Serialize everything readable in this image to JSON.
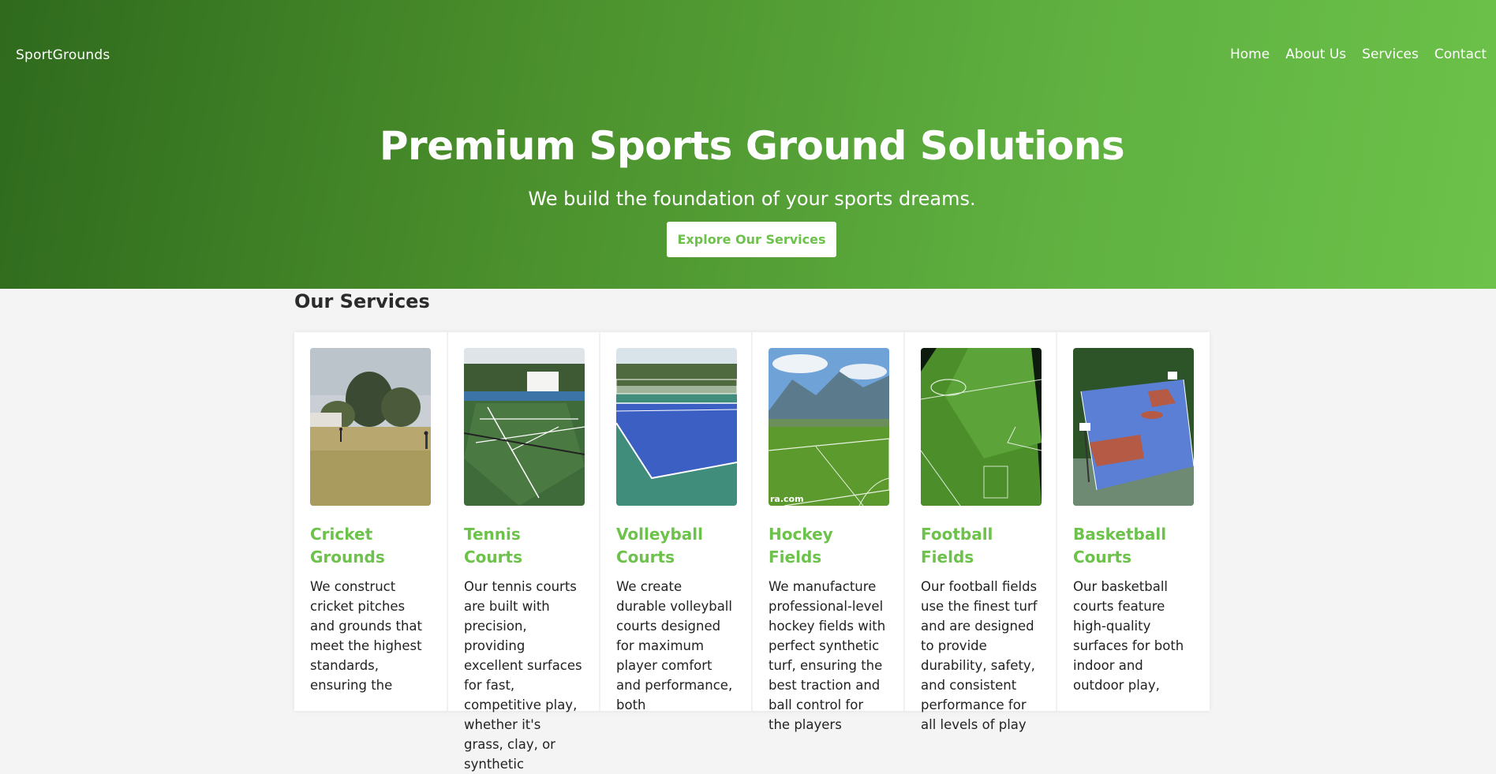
{
  "header": {
    "brand": "SportGrounds",
    "nav": [
      "Home",
      "About Us",
      "Services",
      "Contact"
    ]
  },
  "hero": {
    "title": "Premium Sports Ground Solutions",
    "subtitle": "We build the foundation of your sports dreams.",
    "cta_label": "Explore Our Services"
  },
  "services": {
    "heading": "Our Services",
    "cards": [
      {
        "title": "Cricket Grounds",
        "text": "We construct cricket pitches and grounds that meet the highest standards, ensuring the",
        "image": "cricket-ground-photo"
      },
      {
        "title": "Tennis Courts",
        "text": "Our tennis courts are built with precision, providing excellent surfaces for fast, competitive play, whether it's grass, clay, or synthetic",
        "image": "tennis-court-photo"
      },
      {
        "title": "Volleyball Courts",
        "text": "We create durable volleyball courts designed for maximum player comfort and performance, both",
        "image": "volleyball-court-photo"
      },
      {
        "title": "Hockey Fields",
        "text": "We manufacture professional-level hockey fields with perfect synthetic turf, ensuring the best traction and ball control for the players",
        "image": "hockey-field-photo",
        "watermark": "ra.com"
      },
      {
        "title": "Football Fields",
        "text": "Our football fields use the finest turf and are designed to provide durability, safety, and consistent performance for all levels of play",
        "image": "football-field-photo"
      },
      {
        "title": "Basketball Courts",
        "text": "Our basketball courts feature high-quality surfaces for both indoor and outdoor play,",
        "image": "basketball-court-photo"
      }
    ]
  },
  "colors": {
    "accent": "#6cc24a",
    "hero_dark": "#2f6a1d",
    "background": "#f4f4f4"
  }
}
